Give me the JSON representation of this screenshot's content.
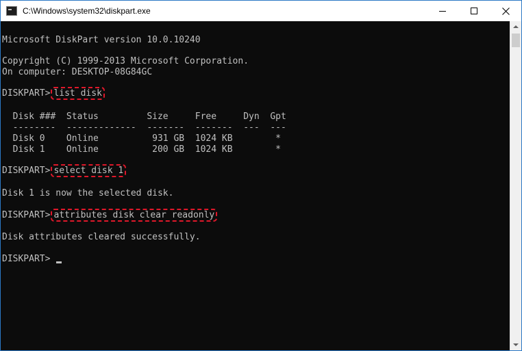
{
  "window": {
    "title": "C:\\Windows\\system32\\diskpart.exe",
    "controls": {
      "minimize": "minimize",
      "maximize": "maximize",
      "close": "✕"
    }
  },
  "console": {
    "version_line": "Microsoft DiskPart version 10.0.10240",
    "copyright_line": "Copyright (C) 1999-2013 Microsoft Corporation.",
    "computer_line": "On computer: DESKTOP-08G84GC",
    "prompt": "DISKPART>",
    "commands": [
      "list disk",
      "select disk 1",
      "attributes disk clear readonly"
    ],
    "table_header": "  Disk ###  Status         Size     Free     Dyn  Gpt",
    "table_separator": "  --------  -------------  -------  -------  ---  ---",
    "table_rows": [
      "  Disk 0    Online          931 GB  1024 KB        *",
      "  Disk 1    Online          200 GB  1024 KB        *"
    ],
    "select_result": "Disk 1 is now the selected disk.",
    "attributes_result": "Disk attributes cleared successfully."
  },
  "colors": {
    "console_bg": "#0c0c0c",
    "console_text": "#c0c0c0",
    "highlight_border": "#e0182a",
    "window_border": "#2b78c5"
  }
}
